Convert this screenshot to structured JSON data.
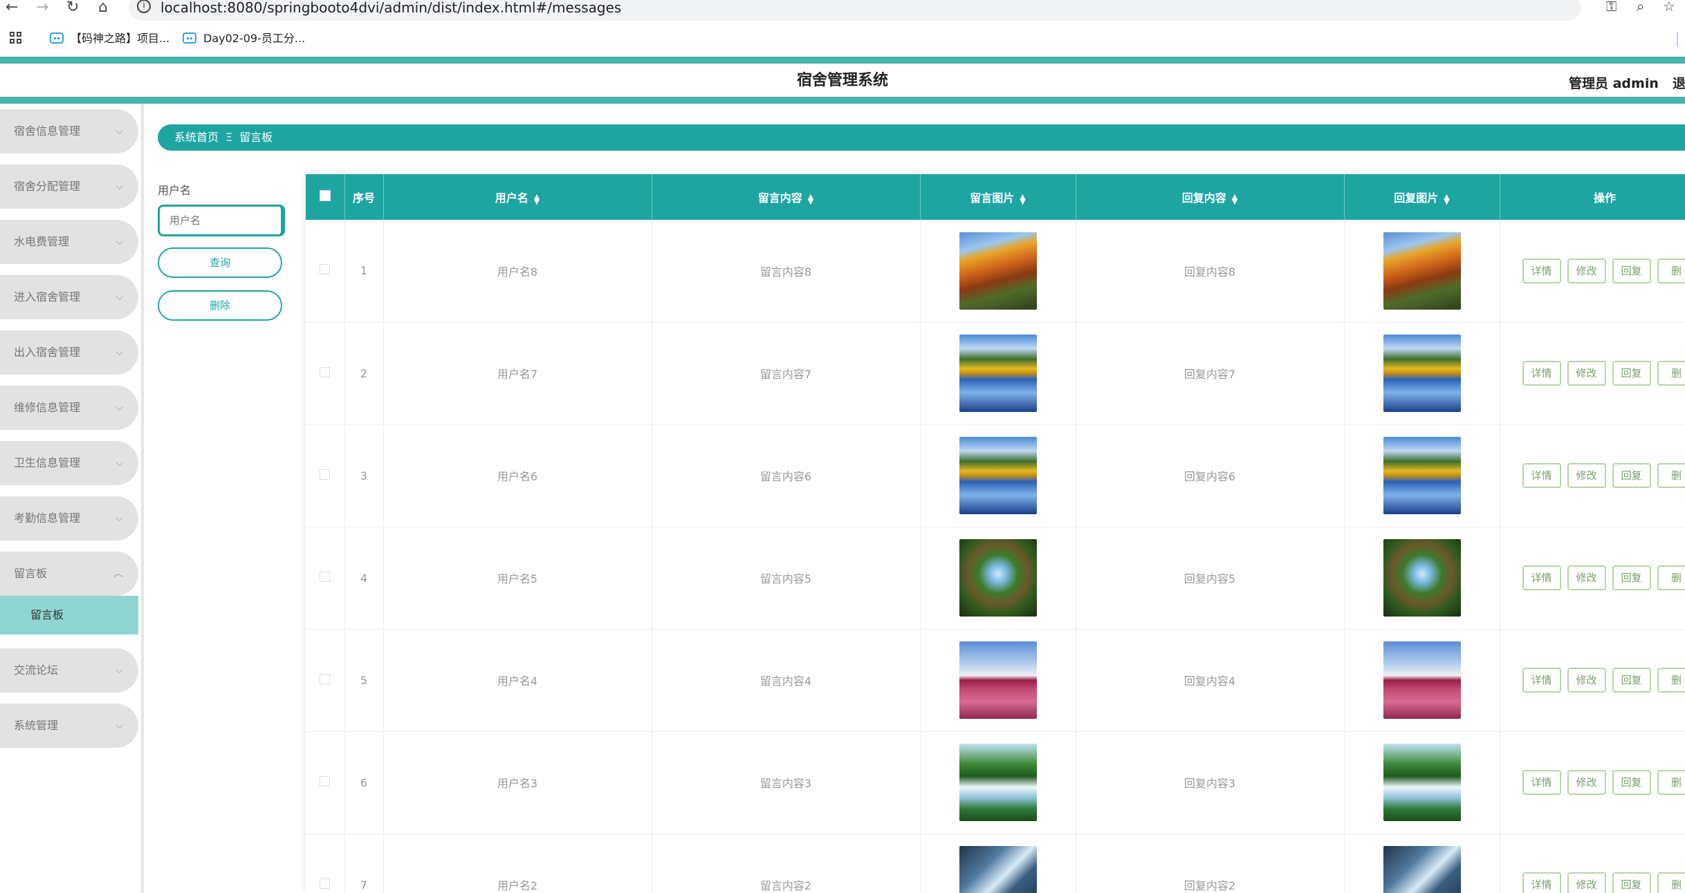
{
  "browser": {
    "url": "localhost:8080/springbooto4dvi/admin/dist/index.html#/messages",
    "bookmarks": [
      "【码神之路】项目...",
      "Day02-09-员工分..."
    ]
  },
  "header": {
    "title": "宿舍管理系统",
    "user": "管理员 admin",
    "logout": "退"
  },
  "sidebar": {
    "items": [
      {
        "label": "宿舍信息管理"
      },
      {
        "label": "宿舍分配管理"
      },
      {
        "label": "水电费管理"
      },
      {
        "label": "进入宿舍管理"
      },
      {
        "label": "出入宿舍管理"
      },
      {
        "label": "维修信息管理"
      },
      {
        "label": "卫生信息管理"
      },
      {
        "label": "考勤信息管理"
      },
      {
        "label": "留言板"
      },
      {
        "label": "交流论坛"
      },
      {
        "label": "系统管理"
      }
    ],
    "active_sub": "留言板"
  },
  "breadcrumb": {
    "home": "系统首页",
    "separator": "Ξ",
    "current": "留言板"
  },
  "search": {
    "label": "用户名",
    "placeholder": "用户名",
    "query_button": "查询",
    "delete_button": "删除"
  },
  "table": {
    "headers": {
      "index": "序号",
      "username": "用户名",
      "content": "留言内容",
      "image": "留言图片",
      "reply": "回复内容",
      "reply_image": "回复图片",
      "actions": "操作"
    },
    "rows": [
      {
        "index": "1",
        "username": "用户名8",
        "content": "留言内容8",
        "reply": "回复内容8",
        "image": "autumn-stairs",
        "reply_image": "autumn-stairs"
      },
      {
        "index": "2",
        "username": "用户名7",
        "content": "留言内容7",
        "reply": "回复内容7",
        "image": "mountain-lake",
        "reply_image": "mountain-lake"
      },
      {
        "index": "3",
        "username": "用户名6",
        "content": "留言内容6",
        "reply": "回复内容6",
        "image": "mountain-lake",
        "reply_image": "mountain-lake"
      },
      {
        "index": "4",
        "username": "用户名5",
        "content": "留言内容5",
        "reply": "回复内容5",
        "image": "forest-canopy",
        "reply_image": "forest-canopy"
      },
      {
        "index": "5",
        "username": "用户名4",
        "content": "留言内容4",
        "reply": "回复内容4",
        "image": "pink-tree",
        "reply_image": "pink-tree"
      },
      {
        "index": "6",
        "username": "用户名3",
        "content": "留言内容3",
        "reply": "回复内容3",
        "image": "waterfall",
        "reply_image": "waterfall"
      },
      {
        "index": "7",
        "username": "用户名2",
        "content": "留言内容2",
        "reply": "回复内容2",
        "image": "canyon-falls",
        "reply_image": "canyon-falls"
      }
    ],
    "row_actions": {
      "detail": "详情",
      "edit": "修改",
      "reply": "回复",
      "delete": "删"
    }
  },
  "colors": {
    "accent": "#1ea5a2",
    "accent_light": "#8fd5d2",
    "topbar_border": "#45b5b0",
    "menu_bg": "#e2e2e2",
    "action_border": "#b8d4a8",
    "action_text": "#7ca06a"
  }
}
